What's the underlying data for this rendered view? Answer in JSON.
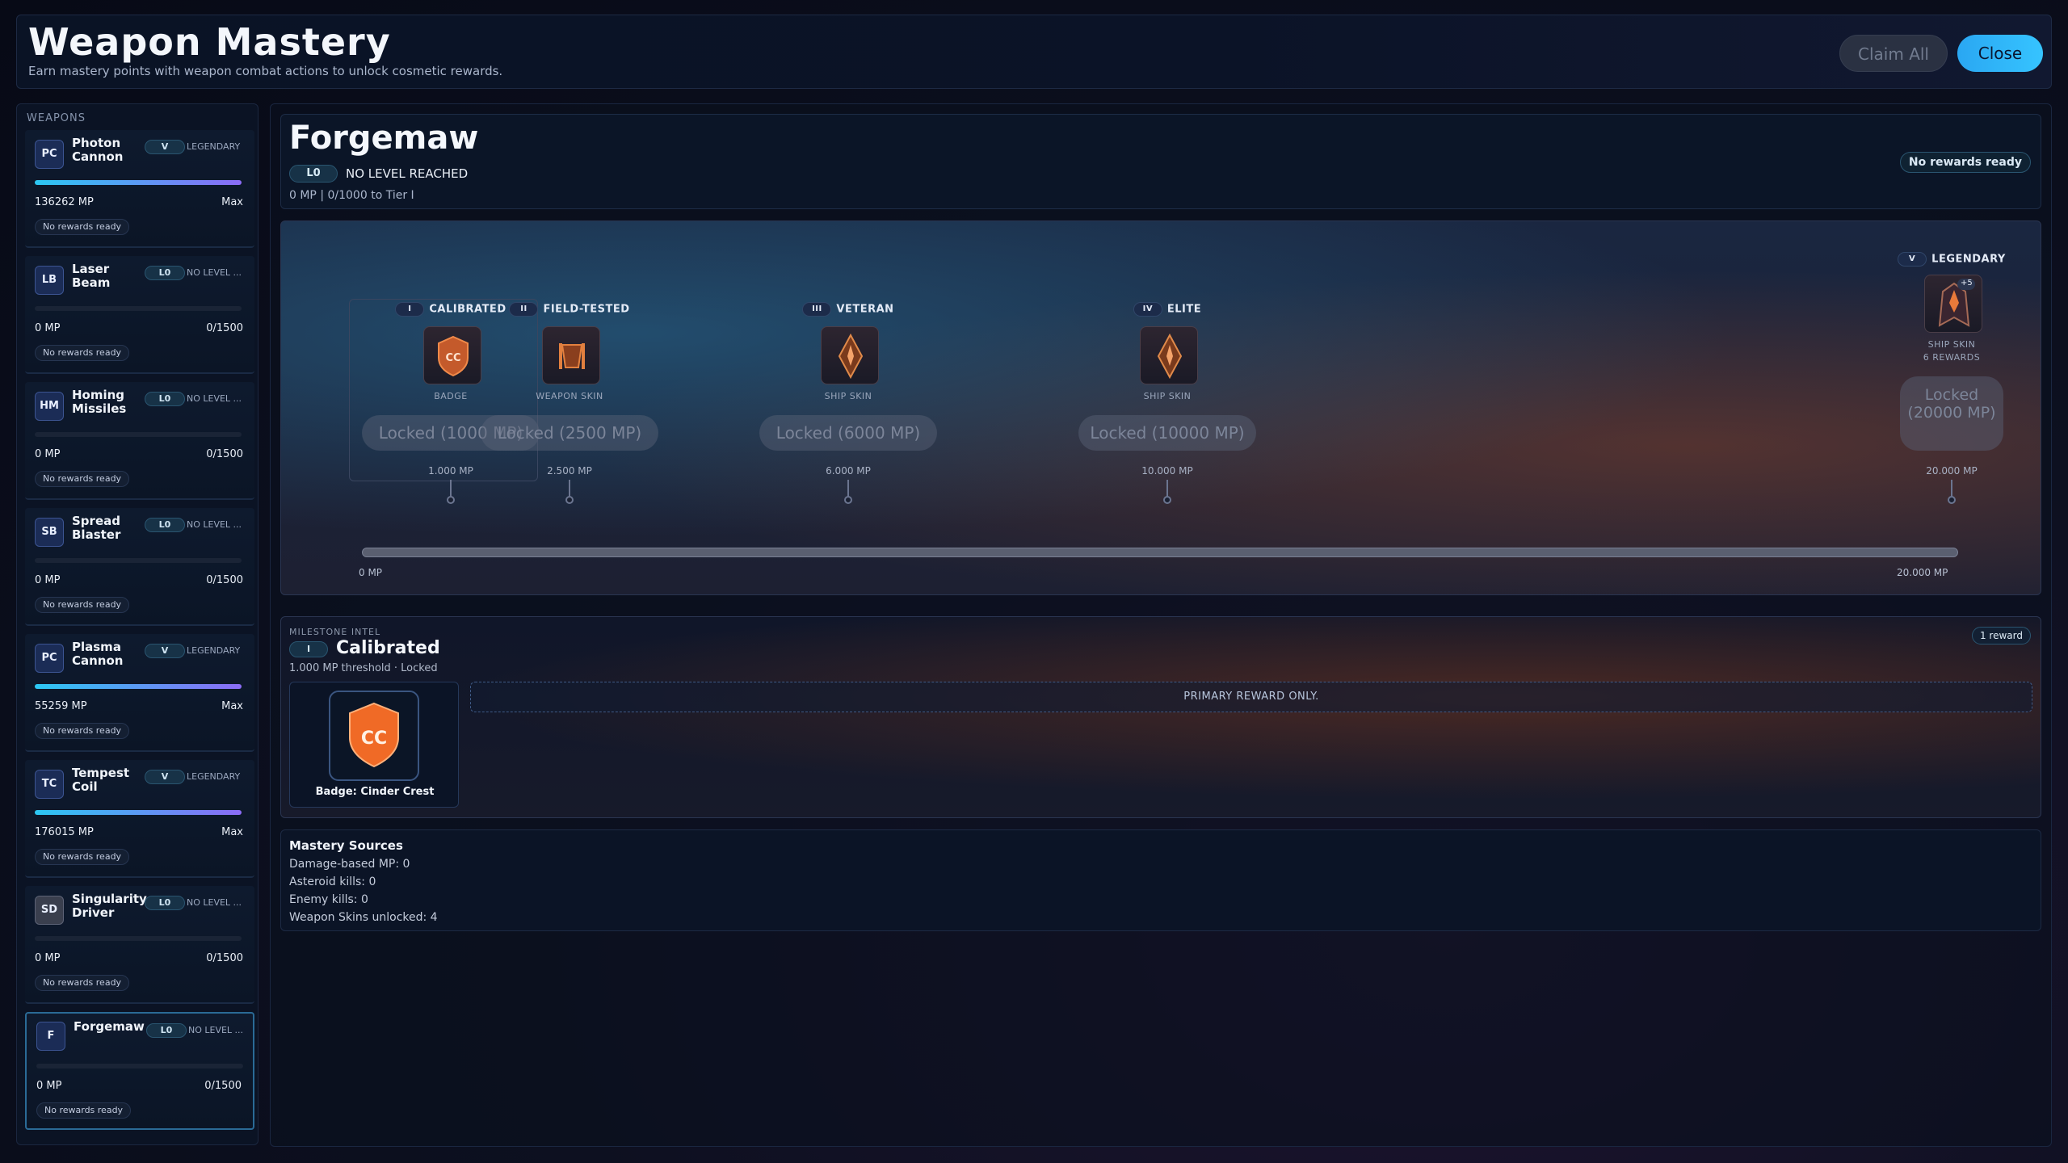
{
  "header": {
    "title": "Weapon Mastery",
    "subtitle": "Earn mastery points with weapon combat actions to unlock cosmetic rewards.",
    "claim_all_label": "Claim All",
    "close_label": "Close"
  },
  "sidebar": {
    "title": "WEAPONS",
    "weapons": [
      {
        "abbr": "PC",
        "name": "Photon Cannon",
        "tier": "V",
        "tier_name": "LEGENDARY",
        "mp": "136262 MP",
        "progress": "Max",
        "ready": "No rewards ready",
        "fill": 1.0
      },
      {
        "abbr": "LB",
        "name": "Laser Beam",
        "tier": "L0",
        "tier_name": "NO LEVEL ...",
        "mp": "0 MP",
        "progress": "0/1500",
        "ready": "No rewards ready",
        "fill": 0.0
      },
      {
        "abbr": "HM",
        "name": "Homing Missiles",
        "tier": "L0",
        "tier_name": "NO LEVEL ...",
        "mp": "0 MP",
        "progress": "0/1500",
        "ready": "No rewards ready",
        "fill": 0.0
      },
      {
        "abbr": "SB",
        "name": "Spread Blaster",
        "tier": "L0",
        "tier_name": "NO LEVEL ...",
        "mp": "0 MP",
        "progress": "0/1500",
        "ready": "No rewards ready",
        "fill": 0.0
      },
      {
        "abbr": "PC",
        "name": "Plasma Cannon",
        "tier": "V",
        "tier_name": "LEGENDARY",
        "mp": "55259 MP",
        "progress": "Max",
        "ready": "No rewards ready",
        "fill": 1.0
      },
      {
        "abbr": "TC",
        "name": "Tempest Coil",
        "tier": "V",
        "tier_name": "LEGENDARY",
        "mp": "176015 MP",
        "progress": "Max",
        "ready": "No rewards ready",
        "fill": 1.0
      },
      {
        "abbr": "SD",
        "name": "Singularity Driver",
        "tier": "L0",
        "tier_name": "NO LEVEL ...",
        "mp": "0 MP",
        "progress": "0/1500",
        "ready": "No rewards ready",
        "fill": 0.0
      },
      {
        "abbr": "F",
        "name": "Forgemaw",
        "tier": "L0",
        "tier_name": "NO LEVEL ...",
        "mp": "0 MP",
        "progress": "0/1500",
        "ready": "No rewards ready",
        "fill": 0.0
      }
    ]
  },
  "selected": {
    "name": "Forgemaw",
    "level_pill": "L0",
    "level_text": "NO LEVEL REACHED",
    "mp_line": "0 MP | 0/1000 to Tier I",
    "ready_badge": "No rewards ready"
  },
  "track": {
    "min_label": "0 MP",
    "max_label": "20.000 MP",
    "max_value": 20000,
    "milestones": [
      {
        "tier": "I",
        "name": "CALIBRATED",
        "type": "BADGE",
        "lock": "Locked (1000 MP)",
        "mp": "1.000 MP",
        "value": 1000,
        "icon": "badge-icon"
      },
      {
        "tier": "II",
        "name": "FIELD-TESTED",
        "type": "WEAPON SKIN",
        "lock": "Locked (2500 MP)",
        "mp": "2.500 MP",
        "value": 2500,
        "icon": "weapon-skin-icon"
      },
      {
        "tier": "III",
        "name": "VETERAN",
        "type": "SHIP SKIN",
        "lock": "Locked (6000 MP)",
        "mp": "6.000 MP",
        "value": 6000,
        "icon": "ship-skin-icon"
      },
      {
        "tier": "IV",
        "name": "ELITE",
        "type": "SHIP SKIN",
        "lock": "Locked (10000 MP)",
        "mp": "10.000 MP",
        "value": 10000,
        "icon": "ship-skin-icon"
      },
      {
        "tier": "V",
        "name": "LEGENDARY",
        "type": "SHIP SKIN",
        "extra": "6 REWARDS",
        "badge": "+5",
        "lock": "Locked (20000 MP)",
        "mp": "20.000 MP",
        "value": 20000,
        "icon": "ship-skin-icon"
      }
    ]
  },
  "intel": {
    "kicker": "MILESTONE INTEL",
    "tier": "I",
    "title": "Calibrated",
    "subtitle": "1.000 MP threshold · Locked",
    "reward_count": "1 reward",
    "reward_label": "Badge: Cinder Crest",
    "primary_only": "PRIMARY REWARD ONLY."
  },
  "sources": {
    "title": "Mastery Sources",
    "lines": [
      "Damage-based MP: 0",
      "Asteroid kills: 0",
      "Enemy kills: 0",
      "Weapon Skins unlocked: 4"
    ]
  },
  "colors": {
    "accent": "#36c4ff",
    "progress_start": "#2bc8f3",
    "progress_end": "#8b6cf6",
    "badge_orange": "#f06a26"
  }
}
